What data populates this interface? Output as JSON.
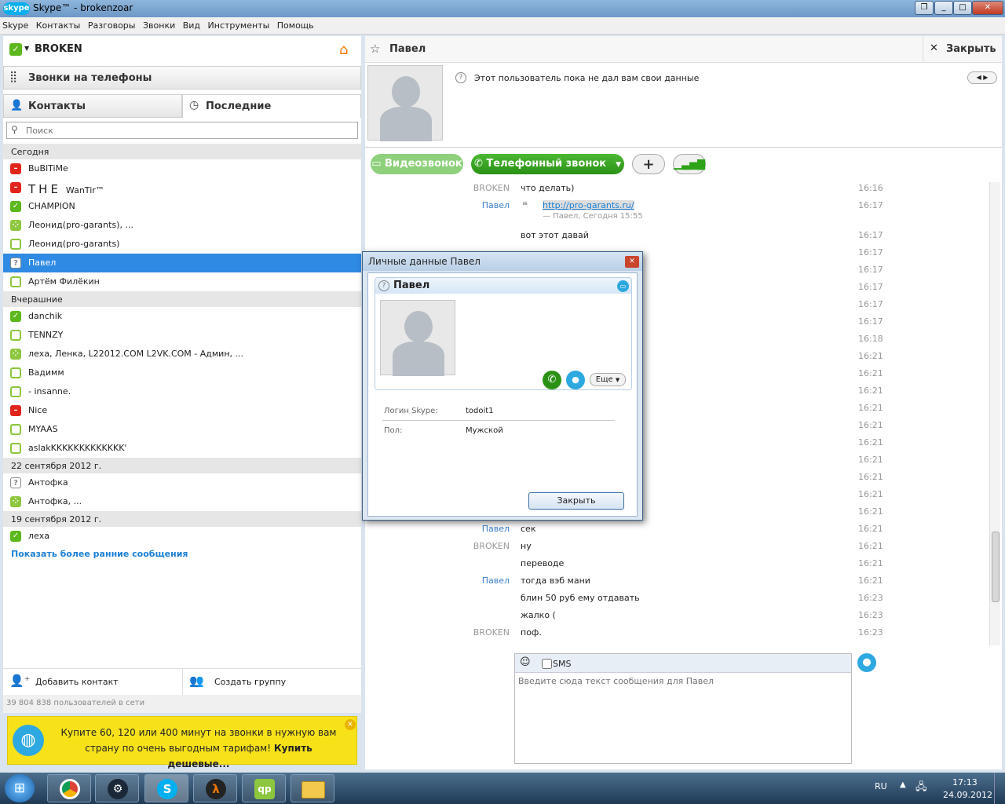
{
  "window": {
    "app_logo": "skype",
    "title": "Skype™ - brokenzoar"
  },
  "menu": [
    "Skype",
    "Контакты",
    "Разговоры",
    "Звонки",
    "Вид",
    "Инструменты",
    "Помощь"
  ],
  "profile": {
    "name": "BROKEN"
  },
  "call_phones": "Звонки на телефоны",
  "tabs": {
    "contacts": "Контакты",
    "recent": "Последние"
  },
  "search": {
    "placeholder": "Поиск"
  },
  "groups": [
    {
      "label": "Сегодня",
      "items": [
        {
          "name": "BuBlTiMe",
          "status": "dnd"
        },
        {
          "name": "THE",
          "suffix": "WanTir™",
          "status": "dnd"
        },
        {
          "name": "CHAMPION",
          "status": "online"
        },
        {
          "name": "Леонид(pro-garants), ...",
          "status": "grp"
        },
        {
          "name": "Леонид(pro-garants)",
          "status": "away"
        },
        {
          "name": "Павел",
          "status": "unk",
          "selected": true
        },
        {
          "name": "Артём Филёкин",
          "status": "away"
        }
      ]
    },
    {
      "label": "Вчерашние",
      "items": [
        {
          "name": "danchik",
          "status": "online"
        },
        {
          "name": "TENNZY",
          "status": "away"
        },
        {
          "name": "леха, Ленка, L22012.COM L2VK.COM - Админ, ...",
          "status": "grp"
        },
        {
          "name": "Вадимм",
          "status": "away"
        },
        {
          "name": "- insanne.",
          "status": "away"
        },
        {
          "name": "Nice",
          "status": "dnd"
        },
        {
          "name": "MYAAS",
          "status": "away"
        },
        {
          "name": "aslakKKKKKKKKKKKKK'",
          "status": "away"
        }
      ]
    },
    {
      "label": "22 сентября 2012 г.",
      "items": [
        {
          "name": "Антофка",
          "status": "unk"
        },
        {
          "name": "Антофка, ...",
          "status": "grp"
        }
      ]
    },
    {
      "label": "19 сентября 2012 г.",
      "items": [
        {
          "name": "леха",
          "status": "online"
        }
      ]
    }
  ],
  "show_earlier": "Показать более ранние сообщения",
  "add_contact": "Добавить контакт",
  "create_group": "Создать группу",
  "online_count": "39 804 838 пользователей в сети",
  "ad": {
    "text": "Купите 60, 120 или 400 минут на звонки в нужную вам страну по очень выгодным тарифам! ",
    "link": "Купить дешевые..."
  },
  "chat": {
    "contact": "Павел",
    "close": "Закрыть",
    "no_info": "Этот пользователь пока не дал вам свои данные",
    "video_btn": "Видеозвонок",
    "phone_btn": "Телефонный звонок",
    "messages": [
      {
        "who": "BROKEN",
        "text": "что делать)",
        "time": "16:16"
      },
      {
        "who": "Павел",
        "text": "http://pro-garants.ru/",
        "time": "16:17",
        "quote": "— Павел, Сегодня 15:55"
      },
      {
        "who": "",
        "text": "вот этот давай",
        "time": "16:17"
      },
      {
        "who": "",
        "text": "",
        "time": "16:17"
      },
      {
        "who": "",
        "text": "",
        "time": "16:17"
      },
      {
        "who": "",
        "text": "",
        "time": "16:17"
      },
      {
        "who": "",
        "text": "",
        "time": "16:17"
      },
      {
        "who": "",
        "text": "",
        "time": "16:17"
      },
      {
        "who": "",
        "text": "",
        "time": "16:18"
      },
      {
        "who": "",
        "text": "",
        "time": "16:21"
      },
      {
        "who": "",
        "text": "",
        "time": "16:21"
      },
      {
        "who": "",
        "text": "",
        "time": "16:21"
      },
      {
        "who": "",
        "text": "",
        "time": "16:21"
      },
      {
        "who": "",
        "text": "",
        "time": "16:21"
      },
      {
        "who": "",
        "text": "",
        "time": "16:21"
      },
      {
        "who": "",
        "text": "",
        "time": "16:21"
      },
      {
        "who": "",
        "text": "",
        "time": "16:21"
      },
      {
        "who": "",
        "text": "",
        "time": "16:21"
      },
      {
        "who": "",
        "text": "",
        "time": "16:21"
      },
      {
        "who": "Павел",
        "text": "сек",
        "time": "16:21"
      },
      {
        "who": "BROKEN",
        "text": "ну",
        "time": "16:21"
      },
      {
        "who": "",
        "text": "переводе",
        "time": "16:21"
      },
      {
        "who": "Павел",
        "text": "тогда вэб мани",
        "time": "16:21"
      },
      {
        "who": "",
        "text": "блин 50 руб ему отдавать",
        "time": "16:23"
      },
      {
        "who": "",
        "text": "жалко (",
        "time": "16:23"
      },
      {
        "who": "BROKEN",
        "text": "поф.",
        "time": "16:23"
      }
    ],
    "sms_label": "SMS",
    "input_placeholder": "Введите сюда текст сообщения для Павел"
  },
  "dialog": {
    "title": "Личные данные Павел",
    "name": "Павел",
    "more": "Еще",
    "login_label": "Логин Skype:",
    "login_value": "todoit1",
    "gender_label": "Пол:",
    "gender_value": "Мужской",
    "close": "Закрыть"
  },
  "tray": {
    "lang": "RU",
    "time": "17:13",
    "date": "24.09.2012"
  },
  "colors": {
    "skype_blue": "#00aff0",
    "green": "#2ea319",
    "selection": "#2f8ae4",
    "link": "#1a7fd4",
    "ad_bg": "#f7e21a"
  }
}
